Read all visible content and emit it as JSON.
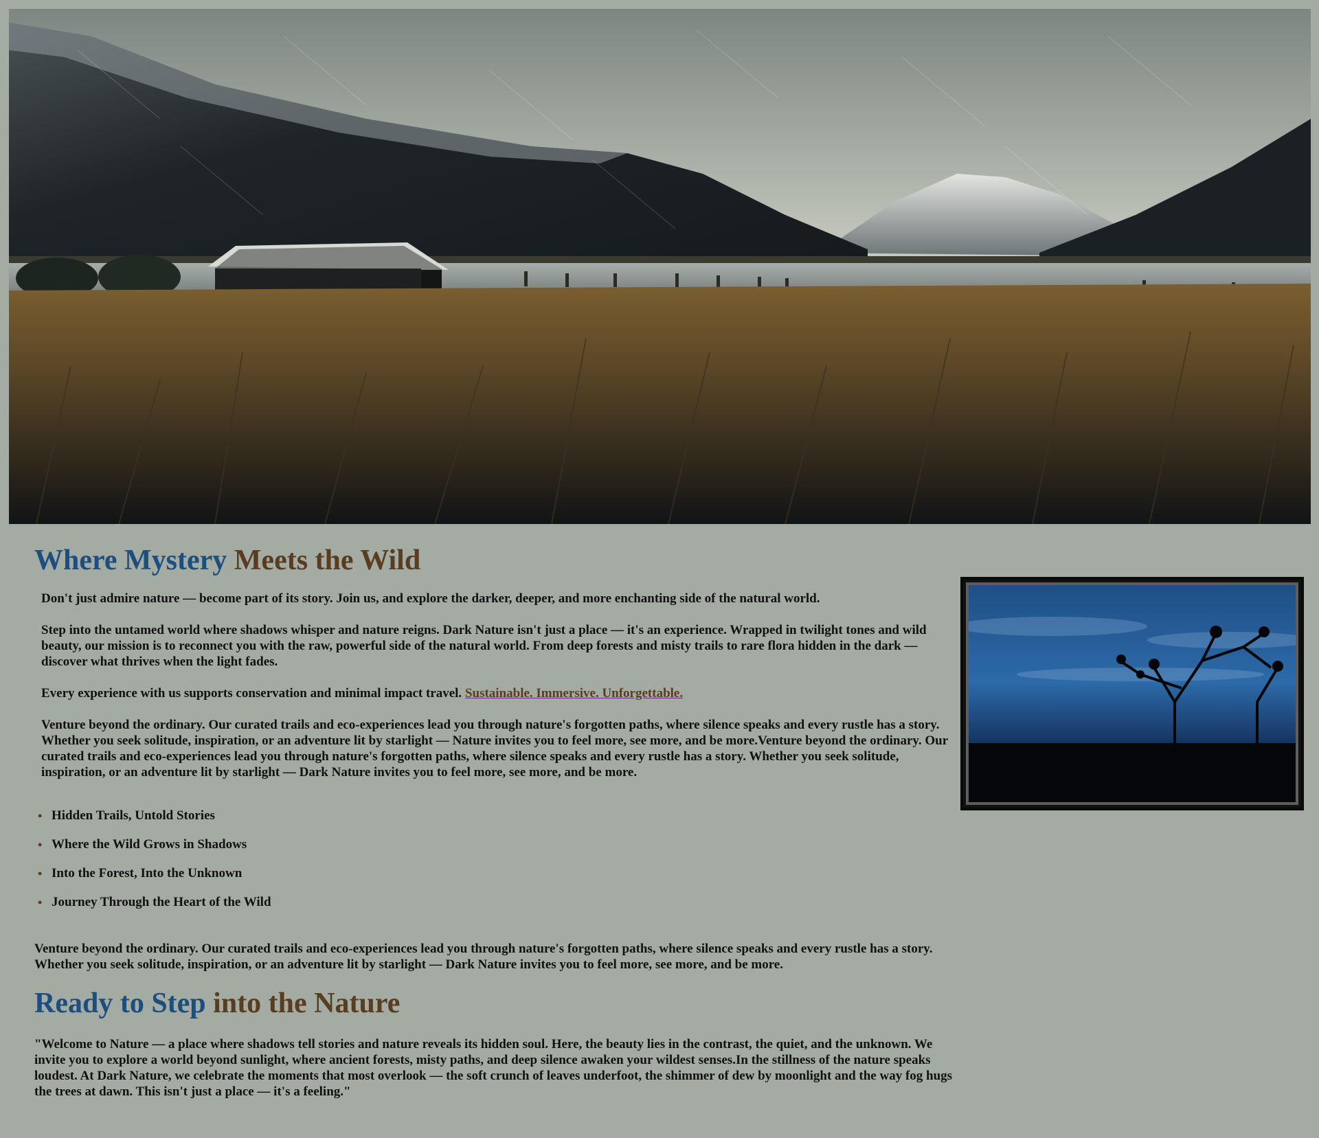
{
  "hero": {
    "image": "misty-mountain-valley-cabin-photo"
  },
  "section1": {
    "title_part1": "Where Mystery",
    "title_part2": "Meets the Wild",
    "intro1": "Don't just admire nature — become part of its story. Join us, and explore the darker, deeper, and more enchanting side of the natural world.",
    "intro2": "Step into the untamed world where shadows whisper and nature reigns. Dark Nature isn't just a place — it's an experience. Wrapped in twilight tones and wild beauty, our mission is to reconnect you with the raw, powerful side of the natural world. From deep forests and misty trails to rare flora hidden in the dark — discover what thrives when the light fades.",
    "intro3_text": "Every experience with us supports conservation and minimal impact travel.",
    "intro3_link": "Sustainable. Immersive. Unforgettable.",
    "intro4": "Venture beyond the ordinary. Our curated trails and eco-experiences lead you through nature's forgotten paths, where silence speaks and every rustle has a story. Whether you seek solitude, inspiration, or an adventure lit by starlight — Nature invites you to feel more, see more, and be more.Venture beyond the ordinary. Our curated trails and eco-experiences lead you through nature's forgotten paths, where silence speaks and every rustle has a story. Whether you seek solitude, inspiration, or an adventure lit by starlight — Dark Nature invites you to feel more, see more, and be more."
  },
  "features": [
    "Hidden Trails, Untold Stories",
    "Where the Wild Grows in Shadows",
    "Into the Forest, Into the Unknown",
    "Journey Through the Heart of the Wild"
  ],
  "bullet": "•",
  "after_list": "Venture beyond the ordinary. Our curated trails and eco-experiences lead you through nature's forgotten paths, where silence speaks and every rustle has a story. Whether you seek solitude, inspiration, or an adventure lit by starlight — Dark Nature invites you to feel more, see more, and be more.",
  "section2": {
    "title_part1": "Ready to Step",
    "title_part2": "into the Nature",
    "quote": "\"Welcome to Nature — a place where shadows tell stories and nature reveals its hidden soul. Here, the beauty lies in the contrast, the quiet, and the unknown. We invite you to explore a world beyond sunlight, where ancient forests, misty paths, and deep silence awaken your wildest senses.In the stillness of the nature speaks loudest. At Dark Nature, we celebrate the moments that most overlook — the soft crunch of leaves underfoot, the shimmer of dew by moonlight and the way fog hugs the trees at dawn. This isn't just a place — it's a feeling.\""
  },
  "side_image": {
    "image": "blue-twilight-tree-silhouette-photo"
  },
  "colors": {
    "background": "#a3aba2",
    "title_blue": "#1d4e80",
    "title_brown": "#5a3d20"
  }
}
